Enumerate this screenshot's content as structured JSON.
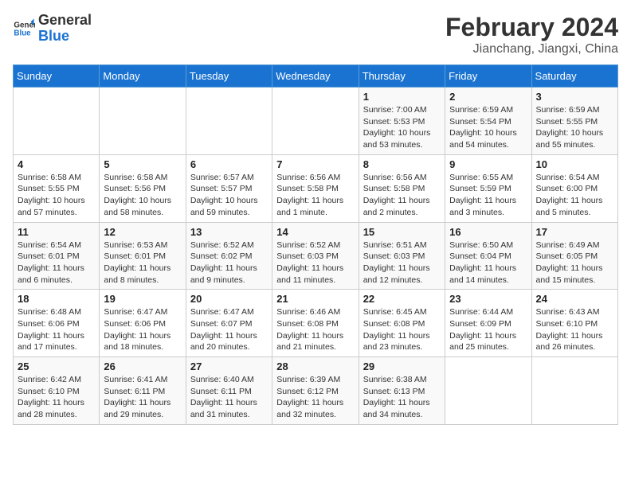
{
  "logo": {
    "line1": "General",
    "line2": "Blue"
  },
  "header": {
    "month_year": "February 2024",
    "location": "Jianchang, Jiangxi, China"
  },
  "weekdays": [
    "Sunday",
    "Monday",
    "Tuesday",
    "Wednesday",
    "Thursday",
    "Friday",
    "Saturday"
  ],
  "weeks": [
    [
      {
        "day": "",
        "info": ""
      },
      {
        "day": "",
        "info": ""
      },
      {
        "day": "",
        "info": ""
      },
      {
        "day": "",
        "info": ""
      },
      {
        "day": "1",
        "info": "Sunrise: 7:00 AM\nSunset: 5:53 PM\nDaylight: 10 hours\nand 53 minutes."
      },
      {
        "day": "2",
        "info": "Sunrise: 6:59 AM\nSunset: 5:54 PM\nDaylight: 10 hours\nand 54 minutes."
      },
      {
        "day": "3",
        "info": "Sunrise: 6:59 AM\nSunset: 5:55 PM\nDaylight: 10 hours\nand 55 minutes."
      }
    ],
    [
      {
        "day": "4",
        "info": "Sunrise: 6:58 AM\nSunset: 5:55 PM\nDaylight: 10 hours\nand 57 minutes."
      },
      {
        "day": "5",
        "info": "Sunrise: 6:58 AM\nSunset: 5:56 PM\nDaylight: 10 hours\nand 58 minutes."
      },
      {
        "day": "6",
        "info": "Sunrise: 6:57 AM\nSunset: 5:57 PM\nDaylight: 10 hours\nand 59 minutes."
      },
      {
        "day": "7",
        "info": "Sunrise: 6:56 AM\nSunset: 5:58 PM\nDaylight: 11 hours\nand 1 minute."
      },
      {
        "day": "8",
        "info": "Sunrise: 6:56 AM\nSunset: 5:58 PM\nDaylight: 11 hours\nand 2 minutes."
      },
      {
        "day": "9",
        "info": "Sunrise: 6:55 AM\nSunset: 5:59 PM\nDaylight: 11 hours\nand 3 minutes."
      },
      {
        "day": "10",
        "info": "Sunrise: 6:54 AM\nSunset: 6:00 PM\nDaylight: 11 hours\nand 5 minutes."
      }
    ],
    [
      {
        "day": "11",
        "info": "Sunrise: 6:54 AM\nSunset: 6:01 PM\nDaylight: 11 hours\nand 6 minutes."
      },
      {
        "day": "12",
        "info": "Sunrise: 6:53 AM\nSunset: 6:01 PM\nDaylight: 11 hours\nand 8 minutes."
      },
      {
        "day": "13",
        "info": "Sunrise: 6:52 AM\nSunset: 6:02 PM\nDaylight: 11 hours\nand 9 minutes."
      },
      {
        "day": "14",
        "info": "Sunrise: 6:52 AM\nSunset: 6:03 PM\nDaylight: 11 hours\nand 11 minutes."
      },
      {
        "day": "15",
        "info": "Sunrise: 6:51 AM\nSunset: 6:03 PM\nDaylight: 11 hours\nand 12 minutes."
      },
      {
        "day": "16",
        "info": "Sunrise: 6:50 AM\nSunset: 6:04 PM\nDaylight: 11 hours\nand 14 minutes."
      },
      {
        "day": "17",
        "info": "Sunrise: 6:49 AM\nSunset: 6:05 PM\nDaylight: 11 hours\nand 15 minutes."
      }
    ],
    [
      {
        "day": "18",
        "info": "Sunrise: 6:48 AM\nSunset: 6:06 PM\nDaylight: 11 hours\nand 17 minutes."
      },
      {
        "day": "19",
        "info": "Sunrise: 6:47 AM\nSunset: 6:06 PM\nDaylight: 11 hours\nand 18 minutes."
      },
      {
        "day": "20",
        "info": "Sunrise: 6:47 AM\nSunset: 6:07 PM\nDaylight: 11 hours\nand 20 minutes."
      },
      {
        "day": "21",
        "info": "Sunrise: 6:46 AM\nSunset: 6:08 PM\nDaylight: 11 hours\nand 21 minutes."
      },
      {
        "day": "22",
        "info": "Sunrise: 6:45 AM\nSunset: 6:08 PM\nDaylight: 11 hours\nand 23 minutes."
      },
      {
        "day": "23",
        "info": "Sunrise: 6:44 AM\nSunset: 6:09 PM\nDaylight: 11 hours\nand 25 minutes."
      },
      {
        "day": "24",
        "info": "Sunrise: 6:43 AM\nSunset: 6:10 PM\nDaylight: 11 hours\nand 26 minutes."
      }
    ],
    [
      {
        "day": "25",
        "info": "Sunrise: 6:42 AM\nSunset: 6:10 PM\nDaylight: 11 hours\nand 28 minutes."
      },
      {
        "day": "26",
        "info": "Sunrise: 6:41 AM\nSunset: 6:11 PM\nDaylight: 11 hours\nand 29 minutes."
      },
      {
        "day": "27",
        "info": "Sunrise: 6:40 AM\nSunset: 6:11 PM\nDaylight: 11 hours\nand 31 minutes."
      },
      {
        "day": "28",
        "info": "Sunrise: 6:39 AM\nSunset: 6:12 PM\nDaylight: 11 hours\nand 32 minutes."
      },
      {
        "day": "29",
        "info": "Sunrise: 6:38 AM\nSunset: 6:13 PM\nDaylight: 11 hours\nand 34 minutes."
      },
      {
        "day": "",
        "info": ""
      },
      {
        "day": "",
        "info": ""
      }
    ]
  ]
}
